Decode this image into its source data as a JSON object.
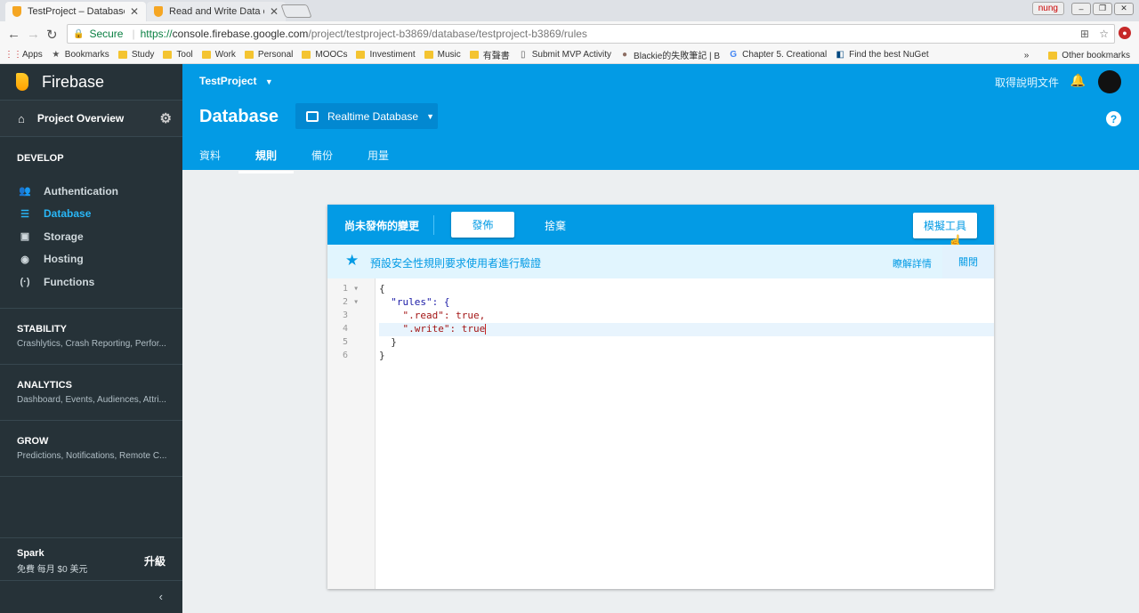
{
  "browser": {
    "tabs": [
      {
        "title": "TestProject – Database -",
        "active": true
      },
      {
        "title": "Read and Write Data on",
        "active": false
      }
    ],
    "user_badge": "nung",
    "url": {
      "secure_label": "Secure",
      "protocol": "https://",
      "host": "console.firebase.google.com",
      "path": "/project/testproject-b3869/database/testproject-b3869/rules"
    },
    "bookmarks": [
      {
        "label": "Apps",
        "icon": "apps-grid-icon"
      },
      {
        "label": "Bookmarks",
        "icon": "star-icon"
      },
      {
        "label": "Study",
        "icon": "folder-icon"
      },
      {
        "label": "Tool",
        "icon": "folder-icon"
      },
      {
        "label": "Work",
        "icon": "folder-icon"
      },
      {
        "label": "Personal",
        "icon": "folder-icon"
      },
      {
        "label": "MOOCs",
        "icon": "folder-icon"
      },
      {
        "label": "Investiment",
        "icon": "folder-icon"
      },
      {
        "label": "Music",
        "icon": "folder-icon"
      },
      {
        "label": "有聲書",
        "icon": "folder-icon"
      },
      {
        "label": "Submit MVP Activity",
        "icon": "page-icon"
      },
      {
        "label": "Blackie的失敗筆記 | B",
        "icon": "avatar-icon"
      },
      {
        "label": "Chapter 5. Creational",
        "icon": "google-icon"
      },
      {
        "label": "Find the best NuGet",
        "icon": "nuget-icon"
      }
    ],
    "overflow": "»",
    "other_bookmarks": "Other bookmarks"
  },
  "sidebar": {
    "brand": "Firebase",
    "project_overview": "Project Overview",
    "develop_title": "DEVELOP",
    "develop_items": [
      {
        "label": "Authentication",
        "icon": "people-icon"
      },
      {
        "label": "Database",
        "icon": "database-icon",
        "active": true
      },
      {
        "label": "Storage",
        "icon": "image-icon"
      },
      {
        "label": "Hosting",
        "icon": "globe-icon"
      },
      {
        "label": "Functions",
        "icon": "functions-icon"
      }
    ],
    "sections": [
      {
        "title": "STABILITY",
        "subtitle": "Crashlytics, Crash Reporting, Perfor..."
      },
      {
        "title": "ANALYTICS",
        "subtitle": "Dashboard, Events, Audiences, Attri..."
      },
      {
        "title": "GROW",
        "subtitle": "Predictions, Notifications, Remote C..."
      }
    ],
    "plan": "Spark",
    "plan_price": "免費 每月 $0 美元",
    "upgrade": "升級",
    "collapse": "‹"
  },
  "header": {
    "project": "TestProject",
    "docs_link": "取得說明文件",
    "title": "Database",
    "db_selector": "Realtime Database",
    "tabs": [
      {
        "label": "資料",
        "active": false
      },
      {
        "label": "規則",
        "active": true
      },
      {
        "label": "備份",
        "active": false
      },
      {
        "label": "用量",
        "active": false
      }
    ],
    "help": "?"
  },
  "rules_card": {
    "unpublished_label": "尚未發佈的變更",
    "publish_button": "發佈",
    "discard_button": "捨棄",
    "simulator_button": "模擬工具",
    "notice_text": "預設安全性規則要求使用者進行驗證",
    "learn_more": "瞭解詳情",
    "close": "關閉"
  },
  "editor": {
    "line_numbers": [
      "1",
      "2",
      "3",
      "4",
      "5",
      "6"
    ],
    "fold_markers": [
      "▾",
      "▾",
      "",
      "",
      "",
      ""
    ],
    "lines": [
      {
        "text": "{"
      },
      {
        "text": "  \"rules\": {"
      },
      {
        "text": "    \".read\": true,"
      },
      {
        "text": "    \".write\": true",
        "highlighted": true
      },
      {
        "text": "  }"
      },
      {
        "text": "}"
      }
    ]
  },
  "colors": {
    "firebase_blue": "#039be5",
    "sidebar_bg": "#263238",
    "active_nav": "#29b6f6",
    "flame_orange": "#ffa000"
  }
}
